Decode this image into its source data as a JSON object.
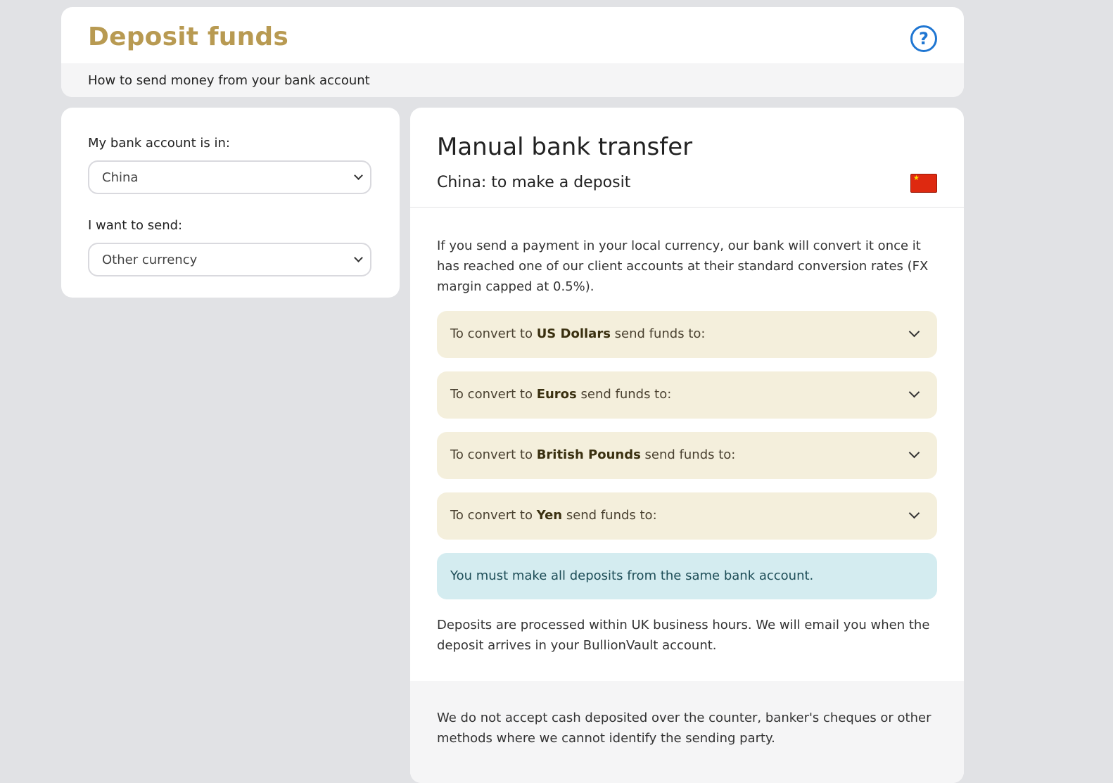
{
  "header": {
    "title": "Deposit funds",
    "subtitle": "How to send money from your bank account",
    "help_icon": "question-circle-icon",
    "help_glyph": "?",
    "title_color": "#b89a52"
  },
  "form": {
    "country_label": "My bank account is in:",
    "country_value": "China",
    "currency_label": "I want to send:",
    "currency_value": "Other currency"
  },
  "transfer": {
    "title": "Manual bank transfer",
    "subtitle": "China: to make a deposit",
    "flag_icon": "china-flag-icon",
    "flag_glyph": "★",
    "intro": "If you send a payment in your local currency, our bank will convert it once it has reached one of our client accounts at their standard conversion rates (FX margin capped at 0.5%).",
    "accordions": [
      {
        "prefix": "To convert to ",
        "currency": "US Dollars",
        "suffix": " send funds to:"
      },
      {
        "prefix": "To convert to ",
        "currency": "Euros",
        "suffix": " send funds to:"
      },
      {
        "prefix": "To convert to ",
        "currency": "British Pounds",
        "suffix": " send funds to:"
      },
      {
        "prefix": "To convert to ",
        "currency": "Yen",
        "suffix": " send funds to:"
      }
    ],
    "notice": "You must make all deposits from the same bank account.",
    "processing": "Deposits are processed within UK business hours. We will email you when the deposit arrives in your BullionVault account.",
    "footer": "We do not accept cash deposited over the counter, banker's cheques or other methods where we cannot identify the sending party."
  },
  "colors": {
    "background": "#e1e2e5",
    "accordion_bg": "#f4efdc",
    "notice_bg": "#d4ecf0",
    "help_icon": "#1f76d2",
    "flag_red": "#de2910"
  }
}
